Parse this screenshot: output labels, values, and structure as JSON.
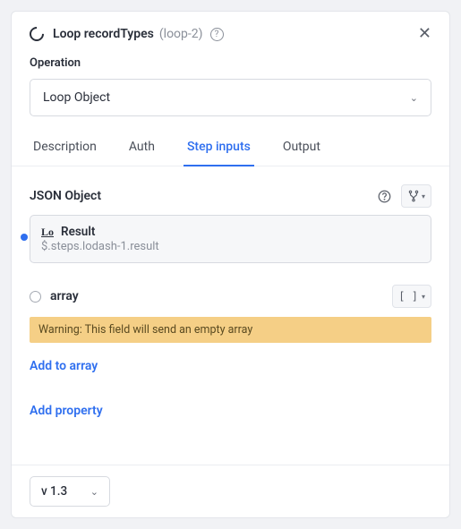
{
  "header": {
    "title": "Loop recordTypes",
    "id": "(loop-2)"
  },
  "operation": {
    "label": "Operation",
    "value": "Loop Object"
  },
  "tabs": {
    "description": "Description",
    "auth": "Auth",
    "step_inputs": "Step inputs",
    "output": "Output"
  },
  "json_object": {
    "label": "JSON Object",
    "provider_icon": "Lo",
    "result_title": "Result",
    "result_path": "$.steps.lodash-1.result"
  },
  "array": {
    "label": "array",
    "type_symbol": "[ ]",
    "warning": "Warning: This field will send an empty array",
    "add_to_array": "Add to array"
  },
  "add_property": "Add property",
  "version": "v 1.3"
}
